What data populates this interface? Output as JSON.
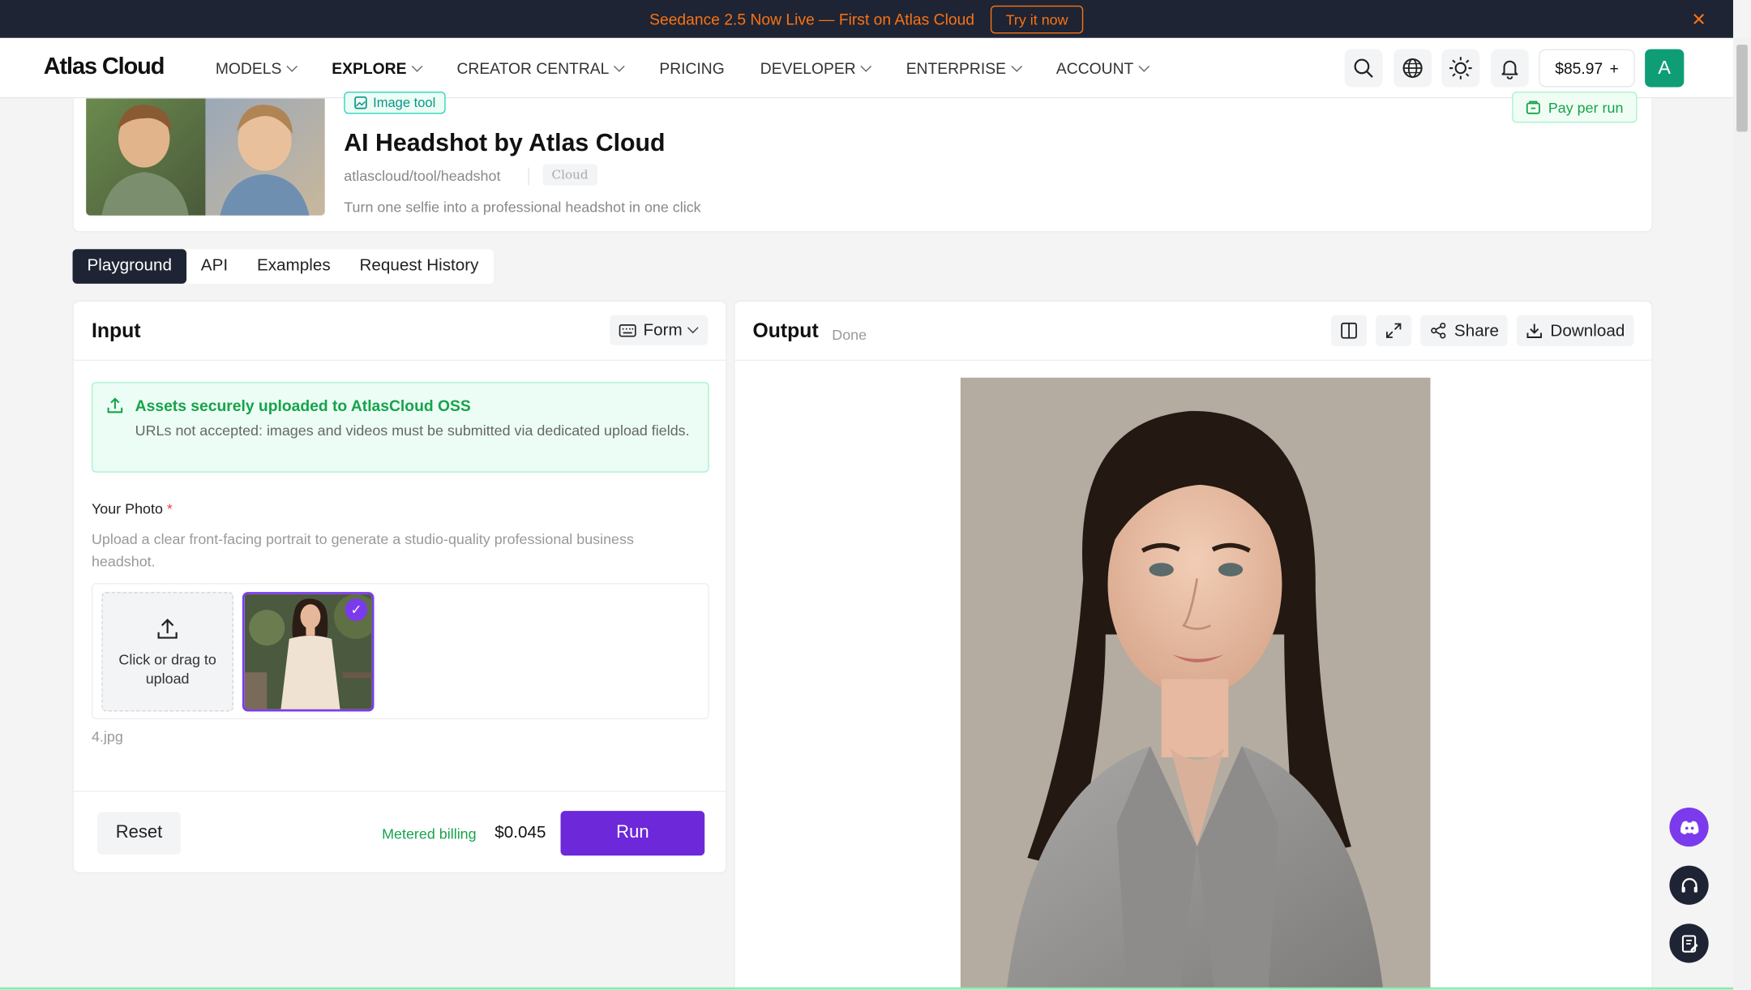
{
  "announcement": {
    "text": "Seedance 2.5 Now Live — First on Atlas Cloud",
    "button": "Try it now",
    "close": "✕"
  },
  "nav": {
    "logo": "Atlas Cloud",
    "items": [
      {
        "label": "MODELS",
        "dropdown": true
      },
      {
        "label": "EXPLORE",
        "dropdown": true
      },
      {
        "label": "CREATOR CENTRAL",
        "dropdown": true
      },
      {
        "label": "PRICING",
        "dropdown": false
      },
      {
        "label": "DEVELOPER",
        "dropdown": true
      },
      {
        "label": "ENTERPRISE",
        "dropdown": true
      },
      {
        "label": "ACCOUNT",
        "dropdown": true
      }
    ],
    "icons": [
      "search-icon",
      "globe-icon",
      "sun-icon",
      "bell-icon"
    ],
    "balance": "$85.97",
    "balance_add": "+",
    "avatar": "A"
  },
  "hero": {
    "badge": "Image tool",
    "title": "AI Headshot by Atlas Cloud",
    "path": "atlascloud/tool/headshot",
    "tag": "Cloud",
    "description": "Turn one selfie into a professional headshot in one click",
    "pay_badge": "Pay per run"
  },
  "tabs": [
    "Playground",
    "API",
    "Examples",
    "Request History"
  ],
  "input": {
    "title": "Input",
    "form_label": "Form",
    "notice_title": "Assets securely uploaded to AtlasCloud OSS",
    "notice_body": "URLs not accepted: images and videos must be submitted via dedicated upload fields.",
    "photo_label": "Your Photo",
    "required_mark": "*",
    "photo_help": "Upload a clear front-facing portrait to generate a studio-quality professional business headshot.",
    "upload_text": "Click or drag to upload",
    "file_name": "4.jpg",
    "reset": "Reset",
    "billing": "Metered billing",
    "price": "$0.045",
    "run": "Run"
  },
  "output": {
    "title": "Output",
    "status": "Done",
    "share": "Share",
    "download": "Download"
  },
  "colors": {
    "accent": "#6d28d9",
    "success": "#16a34a",
    "announce_bg": "#1e2433",
    "announce_fg": "#f97316",
    "avatar": "#0f9d76"
  }
}
